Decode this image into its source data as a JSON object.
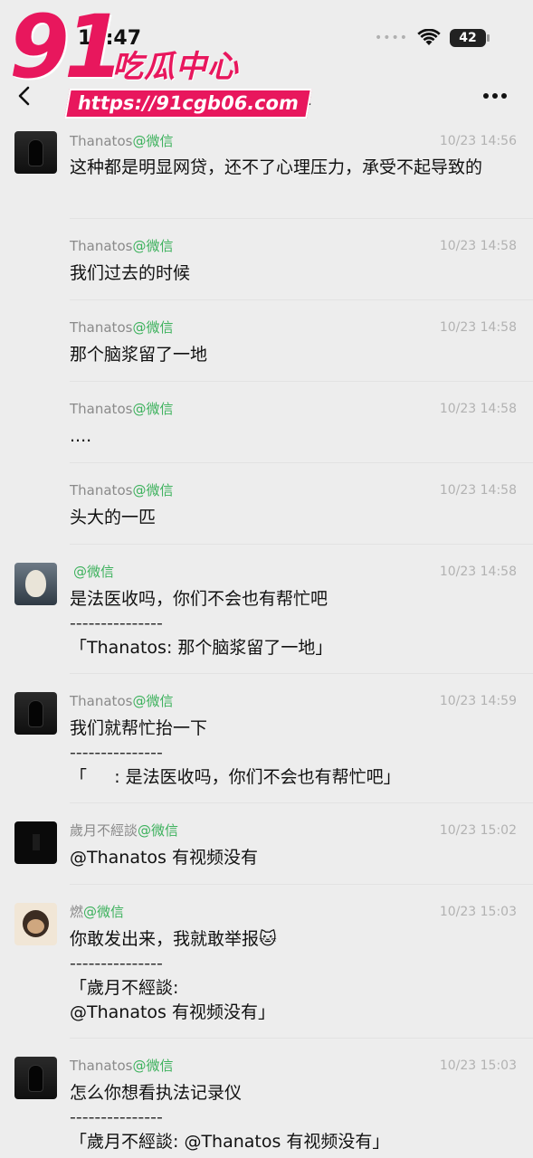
{
  "status_bar": {
    "time": "10:47",
    "signal": "••••",
    "battery": "42"
  },
  "nav": {
    "title": "群聊天记录",
    "back_icon": "chevron-left-icon",
    "more_icon": "more-dots-icon"
  },
  "watermark": {
    "number": "91",
    "name": "吃瓜中心",
    "url": "https://91cgb06.com"
  },
  "messages": [
    {
      "sender": "Thanatos",
      "source": "@微信",
      "time": "10/23 14:56",
      "text": "这种都是明显网贷，还不了心理压力，承受不起导致的",
      "avatar": "dark"
    },
    {
      "sender": "Thanatos",
      "source": "@微信",
      "time": "10/23 14:58",
      "text": "我们过去的时候"
    },
    {
      "sender": "Thanatos",
      "source": "@微信",
      "time": "10/23 14:58",
      "text": "那个脑浆留了一地"
    },
    {
      "sender": "Thanatos",
      "source": "@微信",
      "time": "10/23 14:58",
      "text": "...."
    },
    {
      "sender": "Thanatos",
      "source": "@微信",
      "time": "10/23 14:58",
      "text": "头大的一匹"
    },
    {
      "sender": "",
      "source": "@微信",
      "time": "10/23 14:58",
      "text": "是法医收吗，你们不会也有帮忙吧",
      "quote_sep": "---------------",
      "quote": "「Thanatos: 那个脑浆留了一地」",
      "avatar": "mask"
    },
    {
      "sender": "Thanatos",
      "source": "@微信",
      "time": "10/23 14:59",
      "text": "我们就帮忙抬一下",
      "quote_sep": "---------------",
      "quote": "「     : 是法医收吗，你们不会也有帮忙吧」",
      "avatar": "dark"
    },
    {
      "sender": "歲月不經談",
      "source": "@微信",
      "time": "10/23 15:02",
      "text": "@Thanatos 有视频没有",
      "avatar": "black"
    },
    {
      "sender": "燃",
      "source": "@微信",
      "time": "10/23 15:03",
      "text": "你敢发出来，我就敢举报🐱",
      "quote_sep": "---------------",
      "quote": "「歲月不經談:",
      "quote2": "@Thanatos 有视频没有」",
      "avatar": "dog"
    },
    {
      "sender": "Thanatos",
      "source": "@微信",
      "time": "10/23 15:03",
      "text": "怎么你想看执法记录仪",
      "quote_sep": "---------------",
      "quote": "「歲月不經談: @Thanatos 有视频没有」",
      "avatar": "dark"
    }
  ]
}
